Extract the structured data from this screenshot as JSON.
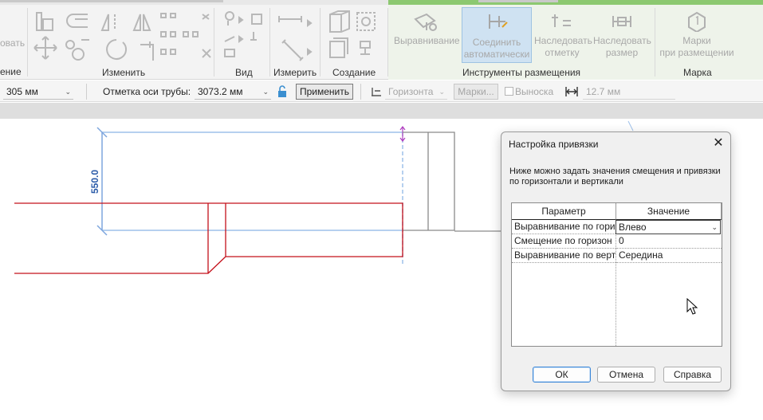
{
  "ribbon": {
    "panels": {
      "modify": "Изменить",
      "view": "Вид",
      "measure": "Измерить",
      "create": "Создание",
      "placement_tools": "Инструменты размещения",
      "tag": "Марка"
    },
    "partial_left_label": "ение",
    "partial_left_btn": "овать",
    "buttons": {
      "justify": "Выравнивание",
      "auto_connect": "Соединить\nавтоматически",
      "inherit_elevation": "Наследовать\nотметку",
      "inherit_size": "Наследовать\nразмер",
      "tag_on_placement": "Марки\nпри размещении"
    },
    "colors": {
      "placement_accent": "#8cc870"
    }
  },
  "options_bar": {
    "diameter_value": "305 мм",
    "pipe_elevation_label": "Отметка оси трубы:",
    "pipe_elevation_value": "3073.2 мм",
    "apply_button": "Применить",
    "horizontal_select": "Горизонта",
    "marks_button": "Марки...",
    "leader_checkbox": "Выноска",
    "leader_length": "12.7 мм"
  },
  "canvas": {
    "dimension_text": "550.0"
  },
  "dialog": {
    "title": "Настройка привязки",
    "description": "Ниже можно задать значения смещения и привязки по горизонтали и вертикали",
    "columns": [
      "Параметр",
      "Значение"
    ],
    "rows": [
      {
        "param": "Выравнивание по гори",
        "value": "Влево"
      },
      {
        "param": "Смещение по горизон",
        "value": "0"
      },
      {
        "param": "Выравнивание по верт",
        "value": "Середина"
      }
    ],
    "buttons": {
      "ok": "ОК",
      "cancel": "Отмена",
      "help": "Справка"
    }
  }
}
